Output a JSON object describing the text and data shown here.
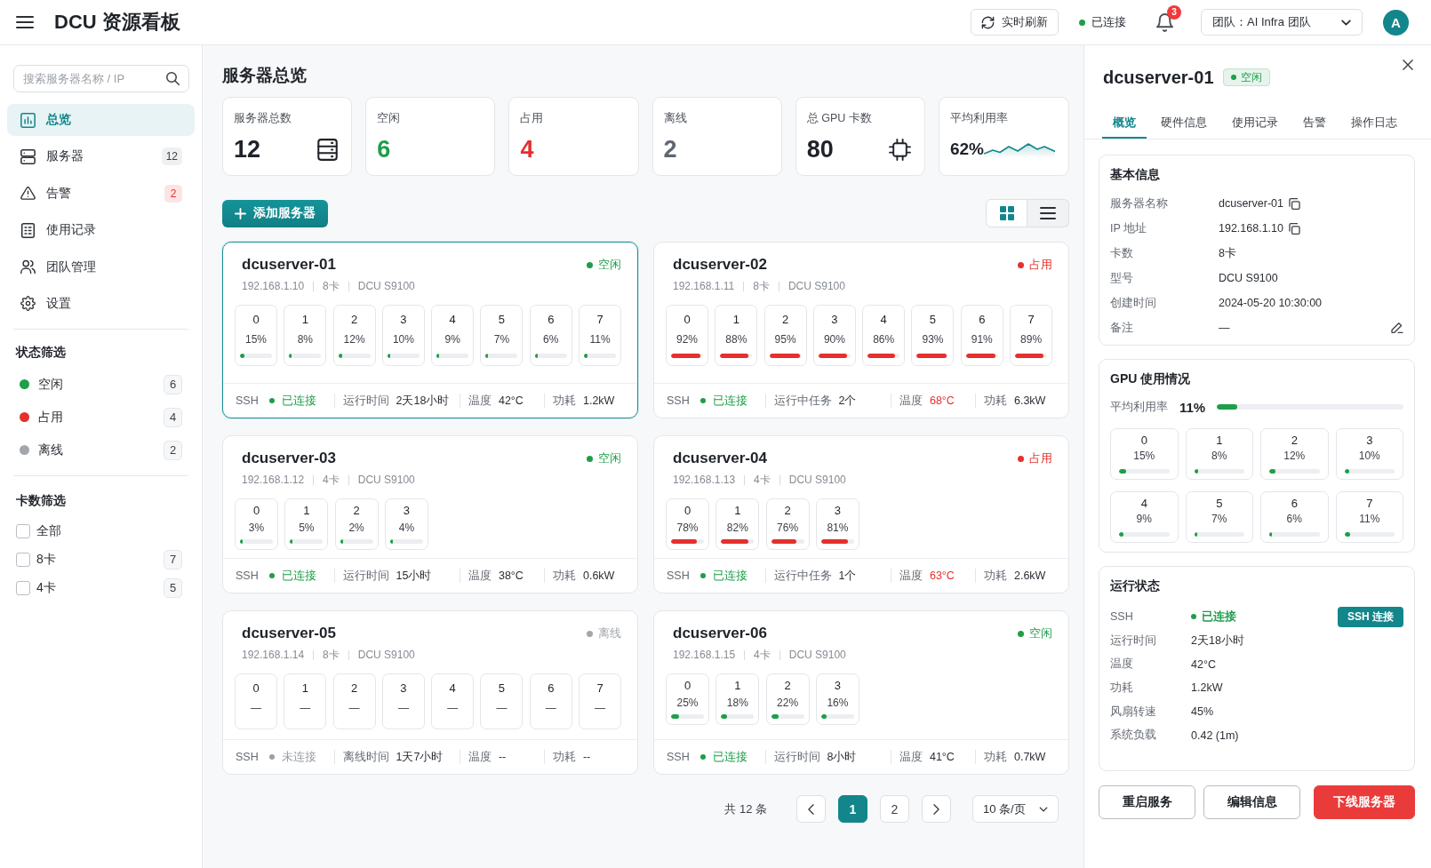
{
  "header": {
    "title": "DCU 资源看板",
    "refresh_button": "实时刷新",
    "connection": {
      "label": "已连接",
      "connected": true
    },
    "notifications": "3",
    "team_select": "团队：AI Infra 团队",
    "avatar": "A"
  },
  "sidebar": {
    "search": {
      "placeholder": "搜索服务器名称 / IP"
    },
    "nav": [
      {
        "label": "总览",
        "selected": true
      },
      {
        "label": "服务器",
        "selected": false,
        "badge": {
          "text": "12",
          "kind": "neutral"
        }
      },
      {
        "label": "告警",
        "selected": false,
        "badge": {
          "text": "2",
          "kind": "alert"
        }
      },
      {
        "label": "使用记录",
        "selected": false
      },
      {
        "label": "团队管理",
        "selected": false
      },
      {
        "label": "设置",
        "selected": false
      }
    ],
    "status_filter": {
      "title": "状态筛选",
      "items": [
        {
          "label": "空闲",
          "count": "6",
          "color": "#1e9e4a"
        },
        {
          "label": "占用",
          "count": "4",
          "color": "#e5302d"
        },
        {
          "label": "离线",
          "count": "2",
          "color": "#a3a7ad"
        }
      ]
    },
    "card_filter": {
      "title": "卡数筛选",
      "items": [
        {
          "label": "全部",
          "checked": false
        },
        {
          "label": "8卡",
          "count": "7",
          "checked": false
        },
        {
          "label": "4卡",
          "count": "5",
          "checked": false
        }
      ]
    }
  },
  "overview": {
    "title": "服务器总览",
    "stats": [
      {
        "label": "服务器总数",
        "value": "12",
        "color": "#1f2329",
        "kind": "server"
      },
      {
        "label": "空闲",
        "value": "6",
        "color": "#1e9e4a",
        "kind": "plain"
      },
      {
        "label": "占用",
        "value": "4",
        "color": "#e5302d",
        "kind": "plain"
      },
      {
        "label": "离线",
        "value": "2",
        "color": "#5f6673",
        "kind": "plain"
      },
      {
        "label": "总 GPU 卡数",
        "value": "80",
        "color": "#1f2329",
        "kind": "chip"
      },
      {
        "label": "平均利用率",
        "value": "62%",
        "color": "#1f2329",
        "kind": "trend"
      }
    ],
    "add_button": "添加服务器",
    "view_toggle": [
      {
        "selected": true
      },
      {
        "selected": false
      }
    ],
    "servers": [
      {
        "name": "dcuserver-01",
        "ip": "192.168.1.10",
        "card_count": "8卡",
        "model": "DCU S9100",
        "status": {
          "label": "空闲",
          "color": "#1e9e4a"
        },
        "selected": true,
        "gpus": [
          {
            "index": "0",
            "usage": "15%",
            "level": 0.15
          },
          {
            "index": "1",
            "usage": "8%",
            "level": 0.08
          },
          {
            "index": "2",
            "usage": "12%",
            "level": 0.12
          },
          {
            "index": "3",
            "usage": "10%",
            "level": 0.1
          },
          {
            "index": "4",
            "usage": "9%",
            "level": 0.09
          },
          {
            "index": "5",
            "usage": "7%",
            "level": 0.07
          },
          {
            "index": "6",
            "usage": "6%",
            "level": 0.06
          },
          {
            "index": "7",
            "usage": "11%",
            "level": 0.11
          }
        ],
        "ssh": {
          "label": "SSH",
          "value": "已连接",
          "connected": true
        },
        "metrics": [
          {
            "label": "运行时间",
            "value": "2天18小时",
            "alert": false
          },
          {
            "label": "温度",
            "value": "42°C",
            "alert": false
          },
          {
            "label": "功耗",
            "value": "1.2kW",
            "alert": false
          }
        ]
      },
      {
        "name": "dcuserver-02",
        "ip": "192.168.1.11",
        "card_count": "8卡",
        "model": "DCU S9100",
        "status": {
          "label": "占用",
          "color": "#e5302d"
        },
        "selected": false,
        "gpus": [
          {
            "index": "0",
            "usage": "92%",
            "level": 0.92
          },
          {
            "index": "1",
            "usage": "88%",
            "level": 0.88
          },
          {
            "index": "2",
            "usage": "95%",
            "level": 0.95
          },
          {
            "index": "3",
            "usage": "90%",
            "level": 0.9
          },
          {
            "index": "4",
            "usage": "86%",
            "level": 0.86
          },
          {
            "index": "5",
            "usage": "93%",
            "level": 0.93
          },
          {
            "index": "6",
            "usage": "91%",
            "level": 0.91
          },
          {
            "index": "7",
            "usage": "89%",
            "level": 0.89
          }
        ],
        "ssh": {
          "label": "SSH",
          "value": "已连接",
          "connected": true
        },
        "metrics": [
          {
            "label": "运行中任务",
            "value": "2个",
            "alert": false
          },
          {
            "label": "温度",
            "value": "68°C",
            "alert": true
          },
          {
            "label": "功耗",
            "value": "6.3kW",
            "alert": false
          }
        ]
      },
      {
        "name": "dcuserver-03",
        "ip": "192.168.1.12",
        "card_count": "4卡",
        "model": "DCU S9100",
        "status": {
          "label": "空闲",
          "color": "#1e9e4a"
        },
        "selected": false,
        "gpus": [
          {
            "index": "0",
            "usage": "3%",
            "level": 0.03
          },
          {
            "index": "1",
            "usage": "5%",
            "level": 0.05
          },
          {
            "index": "2",
            "usage": "2%",
            "level": 0.02
          },
          {
            "index": "3",
            "usage": "4%",
            "level": 0.04
          }
        ],
        "ssh": {
          "label": "SSH",
          "value": "已连接",
          "connected": true
        },
        "metrics": [
          {
            "label": "运行时间",
            "value": "15小时",
            "alert": false
          },
          {
            "label": "温度",
            "value": "38°C",
            "alert": false
          },
          {
            "label": "功耗",
            "value": "0.6kW",
            "alert": false
          }
        ]
      },
      {
        "name": "dcuserver-04",
        "ip": "192.168.1.13",
        "card_count": "4卡",
        "model": "DCU S9100",
        "status": {
          "label": "占用",
          "color": "#e5302d"
        },
        "selected": false,
        "gpus": [
          {
            "index": "0",
            "usage": "78%",
            "level": 0.78
          },
          {
            "index": "1",
            "usage": "82%",
            "level": 0.82
          },
          {
            "index": "2",
            "usage": "76%",
            "level": 0.76
          },
          {
            "index": "3",
            "usage": "81%",
            "level": 0.81
          }
        ],
        "ssh": {
          "label": "SSH",
          "value": "已连接",
          "connected": true
        },
        "metrics": [
          {
            "label": "运行中任务",
            "value": "1个",
            "alert": false
          },
          {
            "label": "温度",
            "value": "63°C",
            "alert": true
          },
          {
            "label": "功耗",
            "value": "2.6kW",
            "alert": false
          }
        ]
      },
      {
        "name": "dcuserver-05",
        "ip": "192.168.1.14",
        "card_count": "8卡",
        "model": "DCU S9100",
        "status": {
          "label": "离线",
          "color": "#a3a7ad"
        },
        "selected": false,
        "gpus": [
          {
            "index": "0",
            "usage": "—"
          },
          {
            "index": "1",
            "usage": "—"
          },
          {
            "index": "2",
            "usage": "—"
          },
          {
            "index": "3",
            "usage": "—"
          },
          {
            "index": "4",
            "usage": "—"
          },
          {
            "index": "5",
            "usage": "—"
          },
          {
            "index": "6",
            "usage": "—"
          },
          {
            "index": "7",
            "usage": "—"
          }
        ],
        "ssh": {
          "label": "SSH",
          "value": "未连接",
          "connected": false
        },
        "metrics": [
          {
            "label": "离线时间",
            "value": "1天7小时",
            "alert": false
          },
          {
            "label": "温度",
            "value": "--",
            "alert": false
          },
          {
            "label": "功耗",
            "value": "--",
            "alert": false
          }
        ]
      },
      {
        "name": "dcuserver-06",
        "ip": "192.168.1.15",
        "card_count": "4卡",
        "model": "DCU S9100",
        "status": {
          "label": "空闲",
          "color": "#1e9e4a"
        },
        "selected": false,
        "gpus": [
          {
            "index": "0",
            "usage": "25%",
            "level": 0.25
          },
          {
            "index": "1",
            "usage": "18%",
            "level": 0.18
          },
          {
            "index": "2",
            "usage": "22%",
            "level": 0.22
          },
          {
            "index": "3",
            "usage": "16%",
            "level": 0.16
          }
        ],
        "ssh": {
          "label": "SSH",
          "value": "已连接",
          "connected": true
        },
        "metrics": [
          {
            "label": "运行时间",
            "value": "8小时",
            "alert": false
          },
          {
            "label": "温度",
            "value": "41°C",
            "alert": false
          },
          {
            "label": "功耗",
            "value": "0.7kW",
            "alert": false
          }
        ]
      }
    ],
    "pagination": {
      "total": "共 12 条",
      "pages": [
        {
          "label": "1",
          "selected": true
        },
        {
          "label": "2",
          "selected": false
        }
      ],
      "page_size": "10 条/页"
    }
  },
  "detail": {
    "title": "dcuserver-01",
    "status": {
      "label": "空闲",
      "color": "#1e9e4a"
    },
    "tabs": [
      {
        "label": "概览",
        "selected": true
      },
      {
        "label": "硬件信息",
        "selected": false
      },
      {
        "label": "使用记录",
        "selected": false
      },
      {
        "label": "告警",
        "selected": false
      },
      {
        "label": "操作日志",
        "selected": false
      }
    ],
    "basic_info": {
      "title": "基本信息",
      "rows": [
        {
          "label": "服务器名称",
          "value": "dcuserver-01",
          "kind": "copy"
        },
        {
          "label": "IP 地址",
          "value": "192.168.1.10",
          "kind": "copy"
        },
        {
          "label": "卡数",
          "value": "8卡",
          "kind": "plain"
        },
        {
          "label": "型号",
          "value": "DCU S9100",
          "kind": "plain"
        },
        {
          "label": "创建时间",
          "value": "2024-05-20 10:30:00",
          "kind": "plain"
        },
        {
          "label": "备注",
          "value": "—",
          "kind": "edit"
        }
      ]
    },
    "gpu_usage": {
      "title": "GPU 使用情况",
      "average": {
        "label": "平均利用率",
        "value": "11%",
        "level": 0.11
      },
      "gpus": [
        {
          "index": "0",
          "usage": "15%",
          "level": 0.15
        },
        {
          "index": "1",
          "usage": "8%",
          "level": 0.08
        },
        {
          "index": "2",
          "usage": "12%",
          "level": 0.12
        },
        {
          "index": "3",
          "usage": "10%",
          "level": 0.1
        },
        {
          "index": "4",
          "usage": "9%",
          "level": 0.09
        },
        {
          "index": "5",
          "usage": "7%",
          "level": 0.07
        },
        {
          "index": "6",
          "usage": "6%",
          "level": 0.06
        },
        {
          "index": "7",
          "usage": "11%",
          "level": 0.11
        }
      ]
    },
    "run_status": {
      "title": "运行状态",
      "ssh": {
        "label": "SSH",
        "value": "已连接",
        "connected": true,
        "button": "SSH 连接"
      },
      "rows": [
        {
          "label": "运行时间",
          "value": "2天18小时"
        },
        {
          "label": "温度",
          "value": "42°C"
        },
        {
          "label": "功耗",
          "value": "1.2kW"
        },
        {
          "label": "风扇转速",
          "value": "45%"
        },
        {
          "label": "系统负载",
          "value": "0.42 (1m)"
        }
      ]
    },
    "actions": [
      {
        "label": "重启服务",
        "kind": "outline"
      },
      {
        "label": "编辑信息",
        "kind": "outline"
      },
      {
        "label": "下线服务器",
        "kind": "danger"
      }
    ]
  }
}
